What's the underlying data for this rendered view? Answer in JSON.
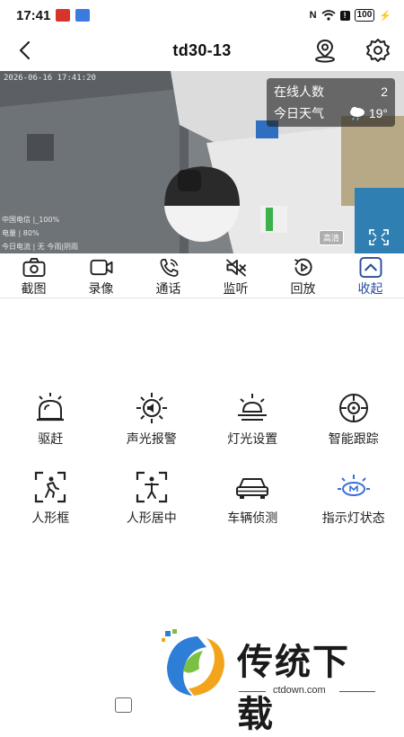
{
  "status_bar": {
    "time": "17:41",
    "battery": "100"
  },
  "header": {
    "title": "td30-13"
  },
  "video": {
    "timestamp": "2026-06-16 17:41:20",
    "osd_lines": [
      "中国电信 |_100%",
      "电量 | 80%",
      "今日电流 | 无 今雨|阴雨"
    ],
    "info": {
      "online_label": "在线人数",
      "online_count": "2",
      "weather_label": "今日天气",
      "temperature": "19°"
    },
    "quality_badge": "高清"
  },
  "toolbar": [
    {
      "label": "截图",
      "icon": "camera-icon"
    },
    {
      "label": "录像",
      "icon": "video-record-icon"
    },
    {
      "label": "通话",
      "icon": "phone-icon"
    },
    {
      "label": "监听",
      "icon": "speaker-muted-icon"
    },
    {
      "label": "回放",
      "icon": "playback-icon"
    },
    {
      "label": "收起",
      "icon": "collapse-icon"
    }
  ],
  "features": [
    {
      "label": "驱赶",
      "icon": "alarm-light-icon"
    },
    {
      "label": "声光报警",
      "icon": "sound-light-alarm-icon"
    },
    {
      "label": "灯光设置",
      "icon": "light-settings-icon"
    },
    {
      "label": "智能跟踪",
      "icon": "smart-tracking-icon"
    },
    {
      "label": "人形框",
      "icon": "human-frame-icon"
    },
    {
      "label": "人形居中",
      "icon": "human-center-icon"
    },
    {
      "label": "车辆侦测",
      "icon": "vehicle-detection-icon"
    },
    {
      "label": "指示灯状态",
      "icon": "indicator-light-icon"
    }
  ],
  "watermark": {
    "text": "传统下载",
    "url": "ctdown.com"
  },
  "colors": {
    "accent": "#2a4d9b",
    "indicator": "#3a6fd8"
  }
}
